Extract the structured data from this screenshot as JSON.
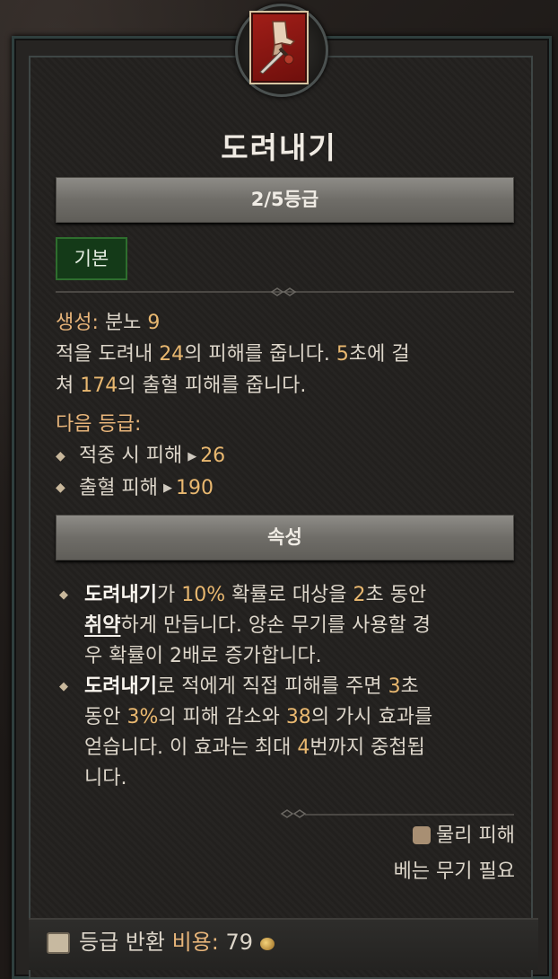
{
  "skill": {
    "name": "도려내기",
    "rank": "2/5등급",
    "tag": "기본",
    "generate_label": "생성:",
    "generate_resource": "분노",
    "generate_value": "9",
    "desc": {
      "p1": "적을 도려내 ",
      "dmg": "24",
      "p2": "의 피해를 줍니다. ",
      "sec": "5",
      "p3": "초에 걸",
      "p4": "쳐 ",
      "bleed": "174",
      "p5": "의 출혈 피해를 줍니다."
    },
    "next_rank_label": "다음 등급:",
    "next_rank": [
      {
        "label": "적중 시 피해",
        "value": "26"
      },
      {
        "label": "출혈 피해",
        "value": "190"
      }
    ]
  },
  "properties": {
    "header": "속성",
    "item1": {
      "skill": "도려내기",
      "a": "가 ",
      "pct": "10%",
      "b": " 확률로 대상을 ",
      "sec": "2",
      "c": "초 동안",
      "vuln": "취약",
      "d": "하게 만듭니다. 양손 무기를 사용할 경",
      "e": "우 확률이 2배로 증가합니다."
    },
    "item2": {
      "skill": "도려내기",
      "a": "로 적에게 직접 피해를 주면 ",
      "sec": "3",
      "b": "초",
      "c": "동안 ",
      "pct": "3%",
      "d": "의 피해 감소와 ",
      "thorns": "38",
      "e": "의 가시 효과를",
      "f": "얻습니다. 이 효과는 최대 ",
      "stacks": "4",
      "g": "번까지 중첩됩",
      "h": "니다."
    }
  },
  "tags": {
    "damage_type": "물리 피해",
    "requirement": "베는 무기 필요"
  },
  "footer": {
    "label": "등급 반환",
    "cost_label": "비용:",
    "cost_value": "79"
  },
  "colors": {
    "highlight": "#e9b870",
    "panel": "#23211f",
    "bar": "#7d7b76",
    "basic_tag": "#143a18"
  }
}
